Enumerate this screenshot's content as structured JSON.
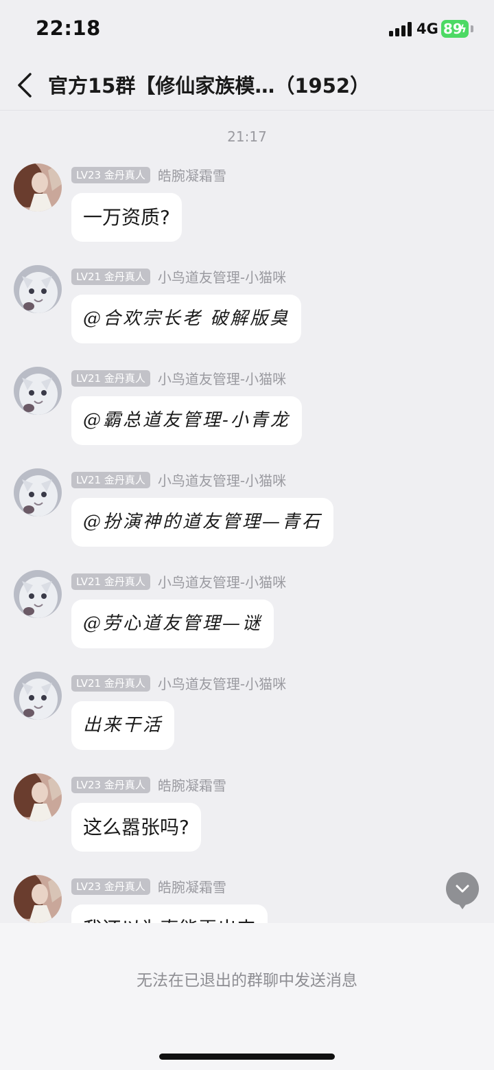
{
  "status_bar": {
    "time": "22:18",
    "network": "4G",
    "battery": "89"
  },
  "nav": {
    "title": "官方15群【修仙家族模…（1952）"
  },
  "chat": {
    "time_divider": "21:17",
    "messages": [
      {
        "level": "LV23 金丹真人",
        "sender": "皓腕凝霜雪",
        "text": "一万资质?",
        "avatar": "warrior-avatar"
      },
      {
        "level": "LV21 金丹真人",
        "sender": "小鸟道友管理-小猫咪",
        "text": "@合欢宗长老 破解版臭",
        "avatar": "cat-avatar"
      },
      {
        "level": "LV21 金丹真人",
        "sender": "小鸟道友管理-小猫咪",
        "text": "@霸总道友管理-小青龙",
        "avatar": "cat-avatar"
      },
      {
        "level": "LV21 金丹真人",
        "sender": "小鸟道友管理-小猫咪",
        "text": "@扮演神的道友管理—青石",
        "avatar": "cat-avatar"
      },
      {
        "level": "LV21 金丹真人",
        "sender": "小鸟道友管理-小猫咪",
        "text": "@劳心道友管理—谜",
        "avatar": "cat-avatar"
      },
      {
        "level": "LV21 金丹真人",
        "sender": "小鸟道友管理-小猫咪",
        "text": "出来干活",
        "avatar": "cat-avatar"
      },
      {
        "level": "LV23 金丹真人",
        "sender": "皓腕凝霜雪",
        "text": "这么嚣张吗?",
        "avatar": "warrior-avatar"
      },
      {
        "level": "LV23 金丹真人",
        "sender": "皓腕凝霜雪",
        "text": "我还以为真能弄出来",
        "avatar": "warrior-avatar"
      }
    ]
  },
  "bottom": {
    "notice": "无法在已退出的群聊中发送消息"
  },
  "colors": {
    "background": "#efeff2",
    "bubble": "#ffffff",
    "battery": "#4cd964",
    "badge": "#c2c2c8"
  }
}
